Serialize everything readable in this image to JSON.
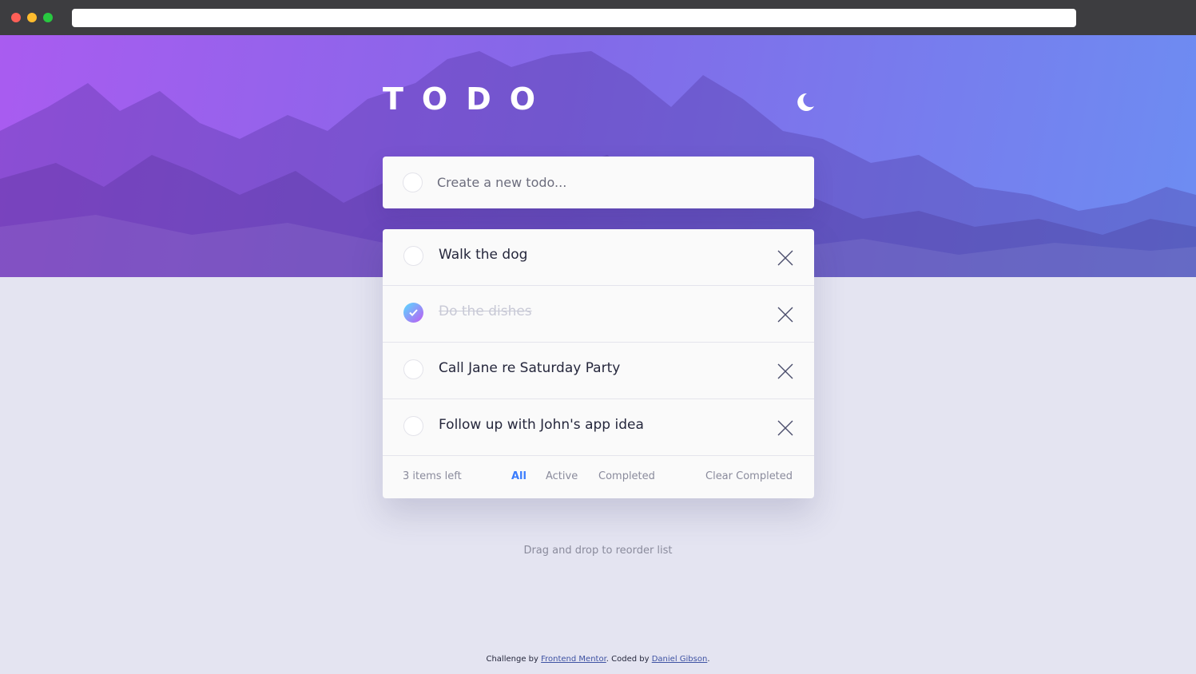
{
  "app": {
    "title": "TODO",
    "theme_toggle_icon": "moon-icon"
  },
  "new_todo": {
    "placeholder": "Create a new todo..."
  },
  "todos": [
    {
      "text": "Walk the dog",
      "completed": false
    },
    {
      "text": "Do the dishes",
      "completed": true
    },
    {
      "text": "Call Jane re Saturday Party",
      "completed": false
    },
    {
      "text": "Follow up with John's app idea",
      "completed": false
    }
  ],
  "footer": {
    "items_left": "3 items left",
    "filters": [
      "All",
      "Active",
      "Completed"
    ],
    "active_filter": "All",
    "clear_completed": "Clear Completed"
  },
  "drag_hint": "Drag and drop to reorder list",
  "attribution": {
    "prefix": "Challenge by ",
    "link1": "Frontend Mentor",
    "middle": ". Coded by ",
    "link2": "Daniel Gibson",
    "suffix": "."
  },
  "colors": {
    "accent": "#3a7cfd",
    "check_gradient_start": "#57ddff",
    "check_gradient_end": "#c058f3",
    "page_background": "#e4e4f1"
  }
}
